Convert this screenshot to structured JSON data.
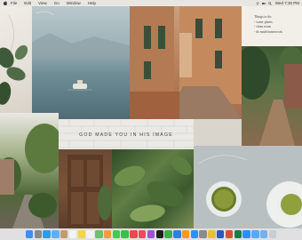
{
  "menubar": {
    "items": [
      "File",
      "Edit",
      "View",
      "Go",
      "Window",
      "Help"
    ],
    "clock": "Wed 7:30 PM"
  },
  "note": {
    "lines": [
      "Things to do:",
      "- water plants",
      "- clean room",
      "- do math homework"
    ]
  },
  "wall": {
    "text": "GOD MADE YOU IN HIS IMAGE"
  },
  "dock": {
    "icons": [
      {
        "name": "finder-icon",
        "color": "#3d8ff0"
      },
      {
        "name": "launchpad-icon",
        "color": "#8a8a8a"
      },
      {
        "name": "safari-icon",
        "color": "#2d9be8"
      },
      {
        "name": "mail-icon",
        "color": "#5ab0f5"
      },
      {
        "name": "contacts-icon",
        "color": "#c49a6c"
      },
      {
        "name": "calendar-icon",
        "color": "#f4f4f4"
      },
      {
        "name": "notes-icon",
        "color": "#f5d34a"
      },
      {
        "name": "reminders-icon",
        "color": "#f2f2f2"
      },
      {
        "name": "maps-icon",
        "color": "#6cc26a"
      },
      {
        "name": "photos-icon",
        "color": "#f29b3c"
      },
      {
        "name": "messages-icon",
        "color": "#45c94f"
      },
      {
        "name": "facetime-icon",
        "color": "#3bbf4a"
      },
      {
        "name": "news-icon",
        "color": "#f04848"
      },
      {
        "name": "music-icon",
        "color": "#f5475d"
      },
      {
        "name": "podcasts-icon",
        "color": "#9b54d6"
      },
      {
        "name": "tv-icon",
        "color": "#1e1e1e"
      },
      {
        "name": "numbers-icon",
        "color": "#3cae4c"
      },
      {
        "name": "keynote-icon",
        "color": "#2f7fe0"
      },
      {
        "name": "pages-icon",
        "color": "#f09a2c"
      },
      {
        "name": "app-store-icon",
        "color": "#2f8ff0"
      },
      {
        "name": "system-preferences-icon",
        "color": "#8b8b8b"
      },
      {
        "name": "chrome-icon",
        "color": "#e9c033"
      },
      {
        "name": "word-icon",
        "color": "#2b5bb8"
      },
      {
        "name": "powerpoint-icon",
        "color": "#d2522f"
      },
      {
        "name": "excel-icon",
        "color": "#217a45"
      },
      {
        "name": "zoom-icon",
        "color": "#2d8cff"
      },
      {
        "name": "folder-icon",
        "color": "#5aa9f0"
      },
      {
        "name": "downloads-icon",
        "color": "#6db2f3"
      },
      {
        "name": "trash-icon",
        "color": "#c9ccd0"
      }
    ]
  }
}
